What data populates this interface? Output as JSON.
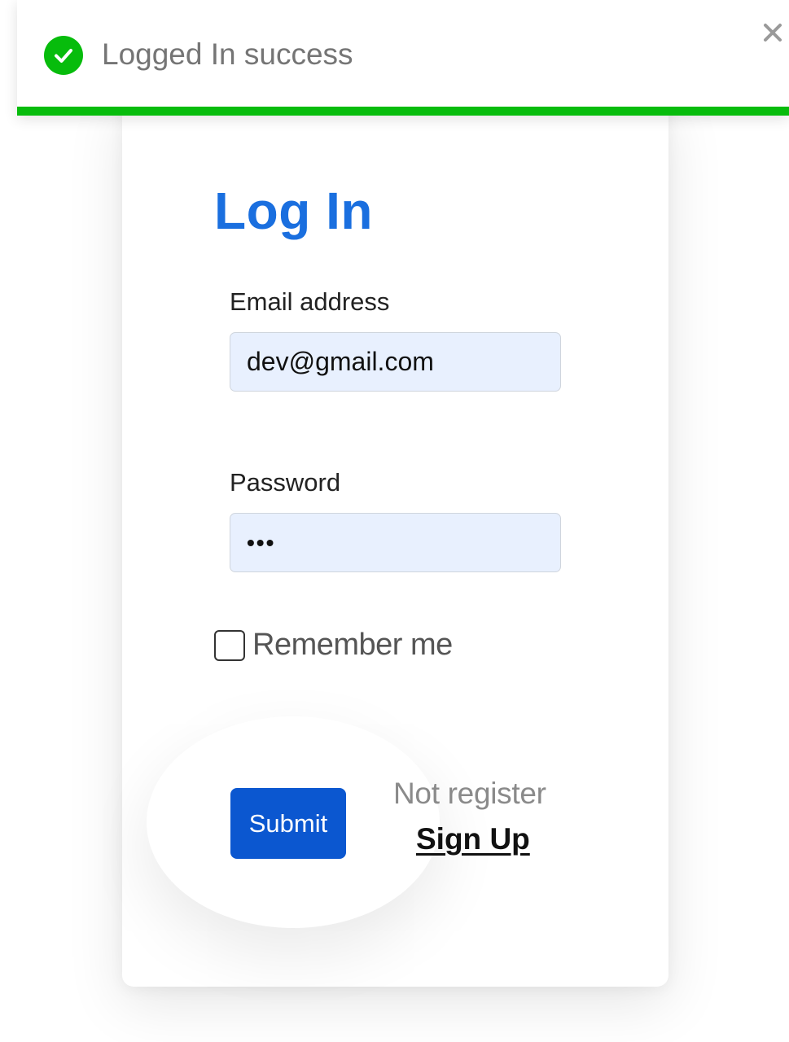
{
  "toast": {
    "message": "Logged In success",
    "icon": "check-circle-icon",
    "close_icon": "close-icon",
    "color": "#07bc0c",
    "progress": 1.0
  },
  "login": {
    "title": "Log In",
    "email_label": "Email address",
    "email_value": "dev@gmail.com",
    "password_label": "Password",
    "password_value": "•••",
    "remember_label": "Remember me",
    "remember_checked": false,
    "submit_label": "Submit",
    "not_register_text": "Not register",
    "signup_label": "Sign Up"
  },
  "colors": {
    "title": "#1a6fdf",
    "submit": "#0b57d0",
    "input_bg": "#e8f0fe"
  }
}
